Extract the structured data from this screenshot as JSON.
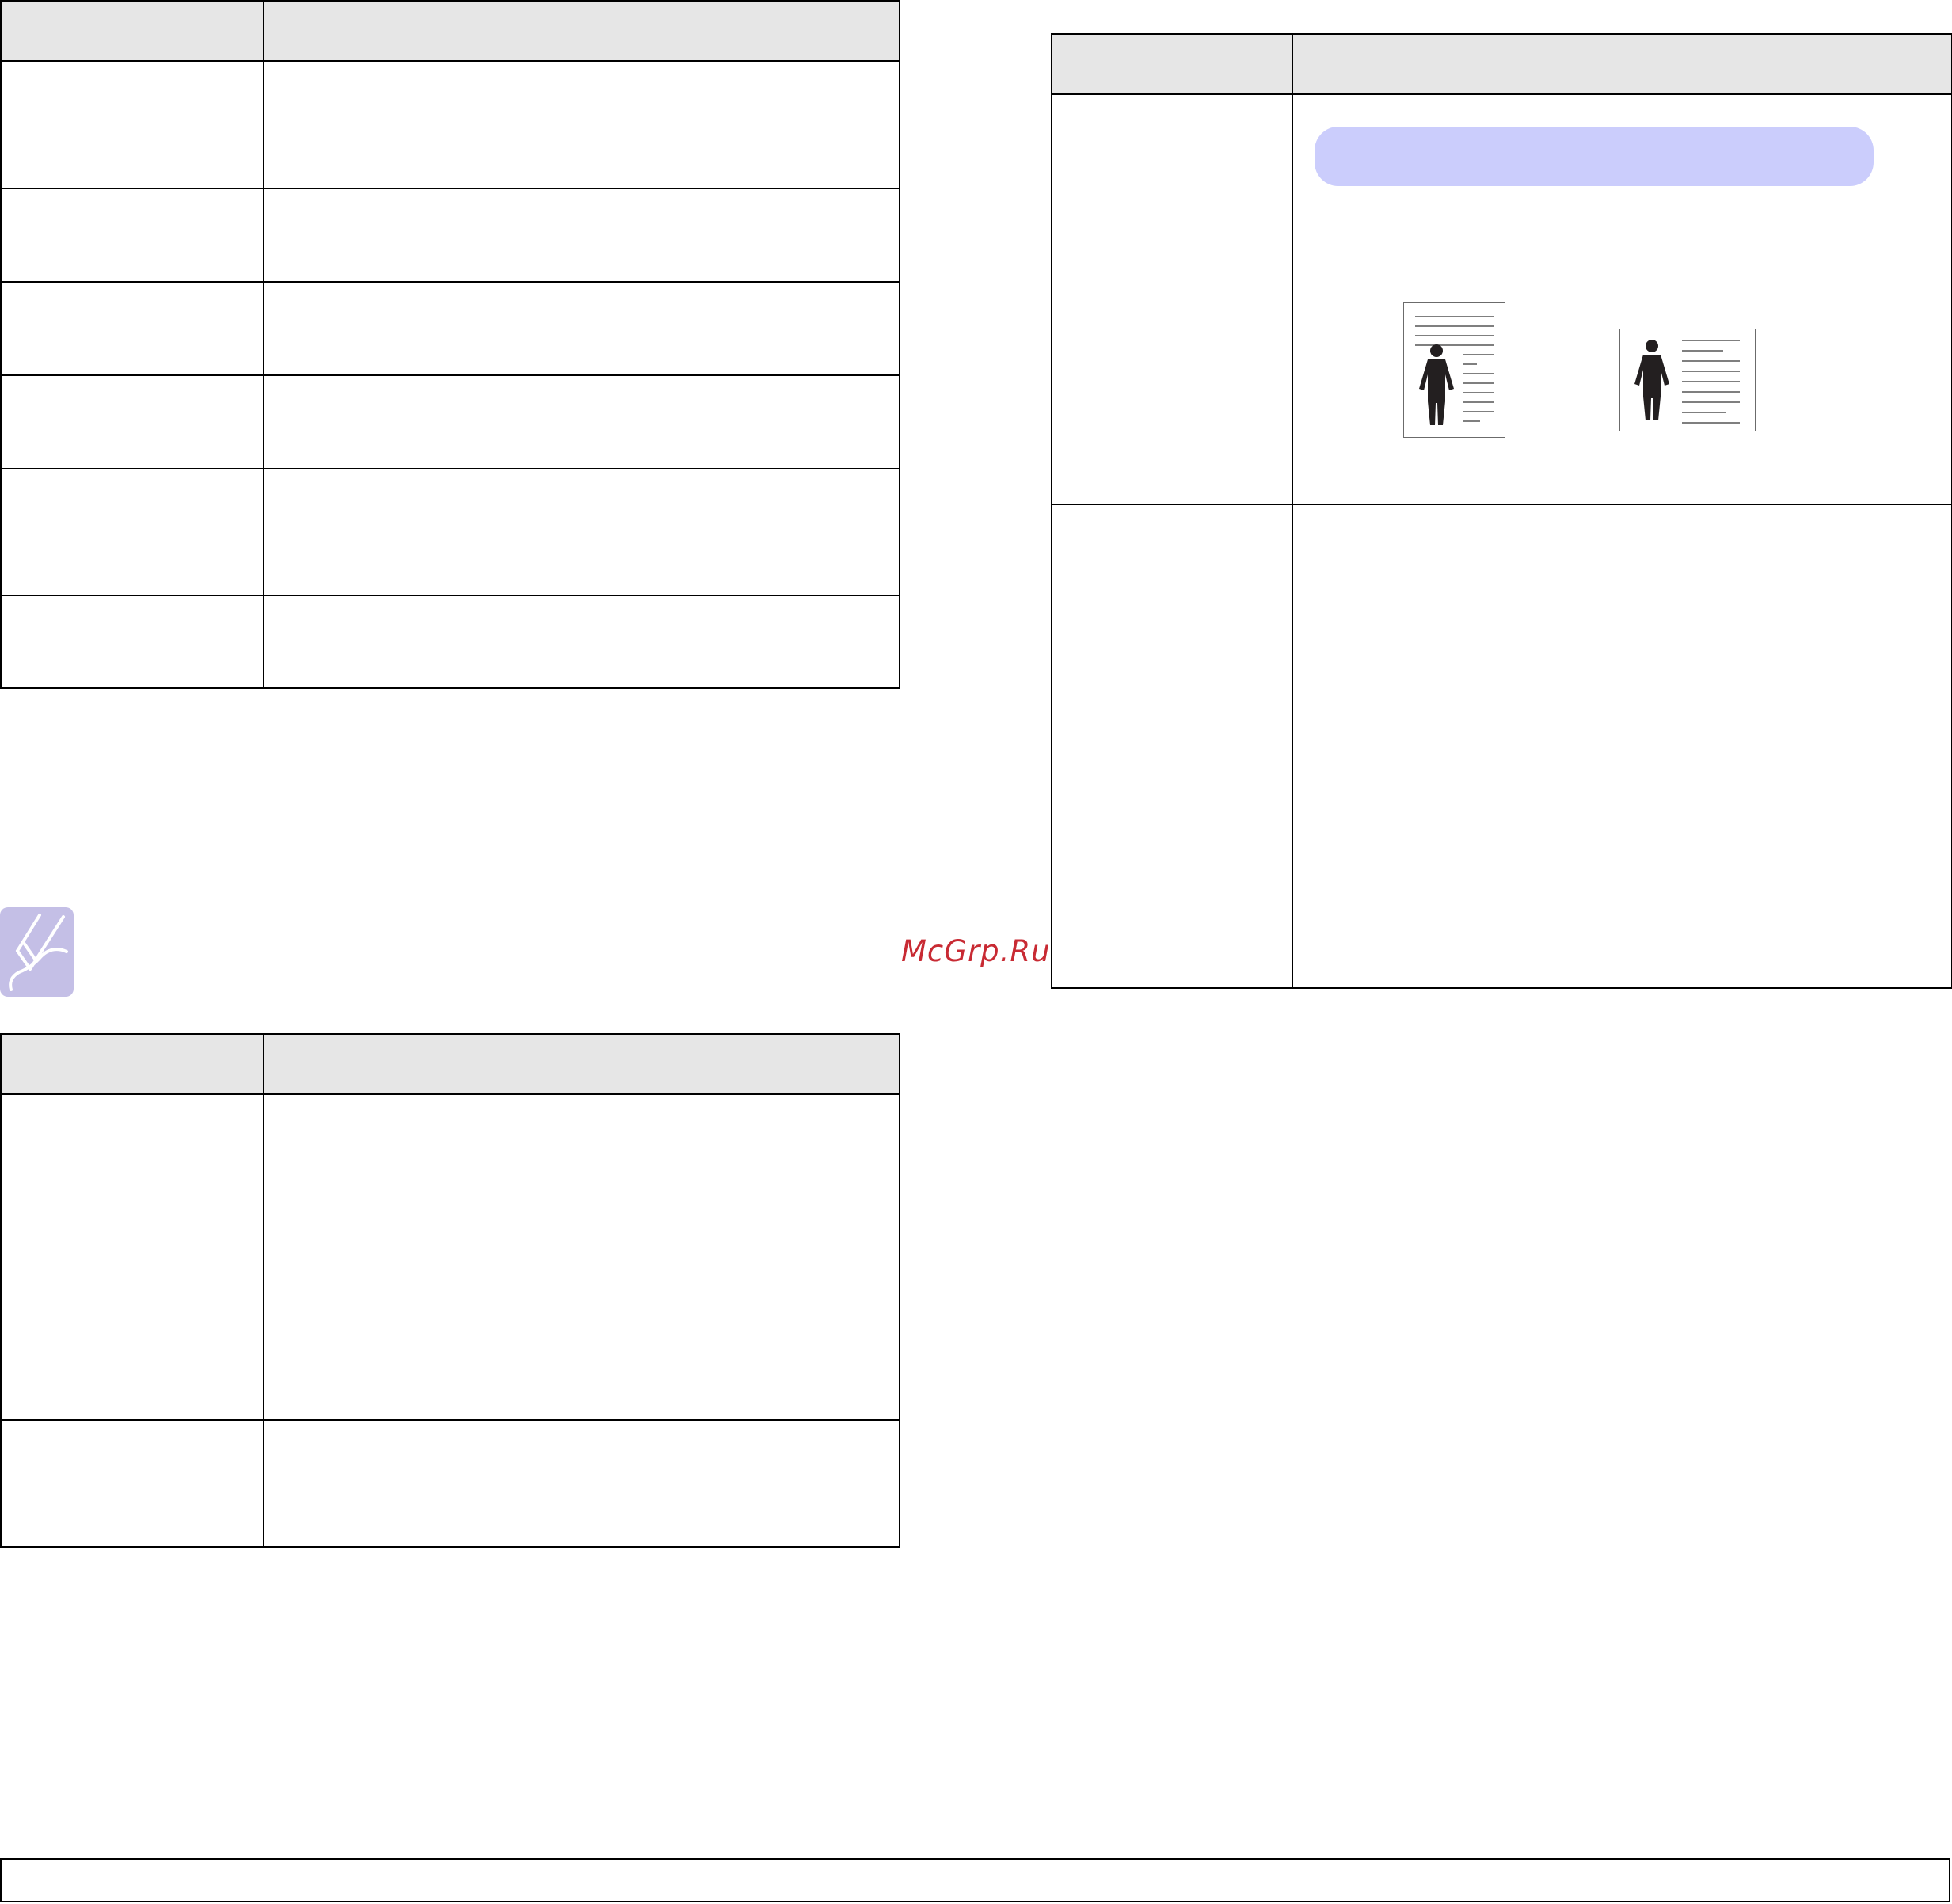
{
  "watermark": {
    "text": "McGrp.Ru"
  },
  "tables": {
    "left_top": {
      "rows": 7
    },
    "left_bottom": {
      "rows": 3
    },
    "right": {
      "rows": 3
    }
  },
  "icons": {
    "note": "note-pencil-icon",
    "portrait": "portrait-page-icon",
    "landscape": "landscape-page-icon"
  },
  "colors": {
    "header_fill": "#e6e6e6",
    "pill_fill": "#cbcdfc",
    "note_icon_fill": "#c4bfe6",
    "watermark": "#c82a33"
  }
}
